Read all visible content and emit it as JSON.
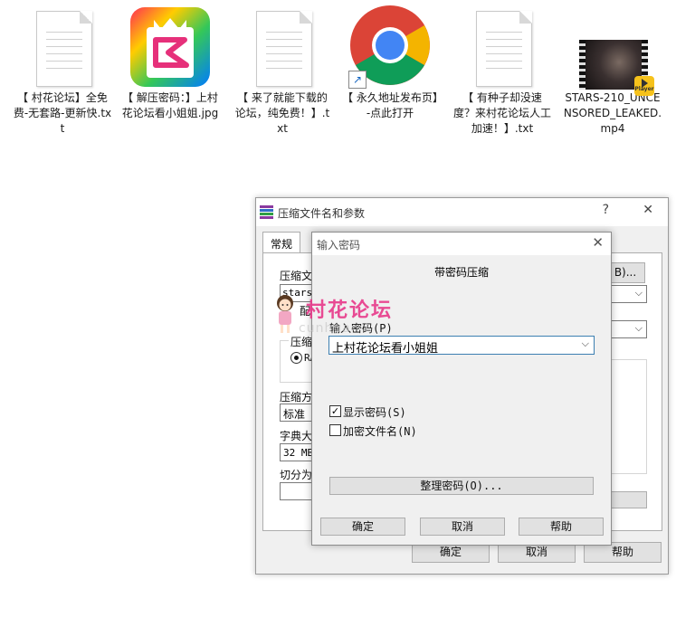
{
  "desktop": {
    "icons": [
      {
        "name": "【 村花论坛】全免费-无套路-更新快.txt",
        "type": "txt"
      },
      {
        "name": "【 解压密码：】上村花论坛看小姐姐.jpg",
        "type": "jpg"
      },
      {
        "name": "【 来了就能下载的论坛，纯免费！】.txt",
        "type": "txt"
      },
      {
        "name": "【 永久地址发布页】-点此打开",
        "type": "chrome-shortcut"
      },
      {
        "name": "【 有种子却没速度？来村花论坛人工加速！】.txt",
        "type": "txt"
      },
      {
        "name": "STARS-210_UNCENSORED_LEAKED.mp4",
        "type": "mp4"
      }
    ],
    "player_badge": "Player"
  },
  "archive_window": {
    "title": "压缩文件名和参数",
    "help_glyph": "?",
    "close_glyph": "✕",
    "tab_general": "常规",
    "frag_archive_name": "压缩文",
    "frag_archive_value": "stars",
    "frag_profile": "配",
    "frag_format": "压缩",
    "frag_rar": "RA",
    "frag_method": "压缩方",
    "method_value": "标准",
    "frag_dict": "字典大",
    "dict_value": "32 MB",
    "frag_split": "切分为",
    "browse_fragment": "B)...",
    "ok": "确定",
    "cancel": "取消",
    "help": "帮助"
  },
  "password_dialog": {
    "title": "输入密码",
    "heading": "带密码压缩",
    "enter_label": "输入密码(P)",
    "password_value": "上村花论坛看小姐姐",
    "show_password": "显示密码(S)",
    "show_password_checked": true,
    "encrypt_names": "加密文件名(N)",
    "encrypt_names_checked": false,
    "organize": "整理密码(O)...",
    "ok": "确定",
    "cancel": "取消",
    "help": "帮助"
  },
  "watermark": {
    "text": "村花论坛",
    "subtext": "cunhua"
  },
  "colors": {
    "watermark_pink": "#e8398a",
    "window_bg": "#f0f0f0",
    "chrome_red": "#db4437",
    "chrome_yellow": "#f4b400",
    "chrome_green": "#0f9d58",
    "chrome_blue": "#4285f4"
  }
}
